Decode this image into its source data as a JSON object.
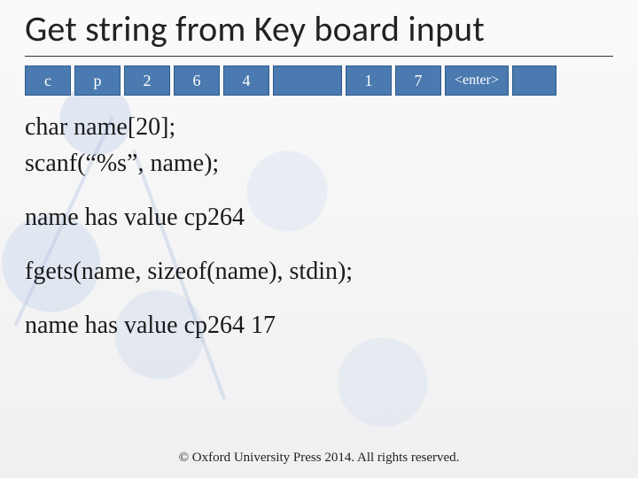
{
  "title": "Get string from Key board input",
  "keys": {
    "k1": "c",
    "k2": "p",
    "k3": "2",
    "k4": "6",
    "k5": "4",
    "gap": "",
    "k6": "1",
    "k7": "7",
    "enter": "<enter>",
    "tail": ""
  },
  "code": {
    "decl": "char name[20];",
    "scanf": "scanf(“%s”, name);",
    "result1": "name has value cp264",
    "fgets": "fgets(name, sizeof(name), stdin);",
    "result2": "name has value cp264 17"
  },
  "footer": "© Oxford University Press 2014. All rights reserved."
}
